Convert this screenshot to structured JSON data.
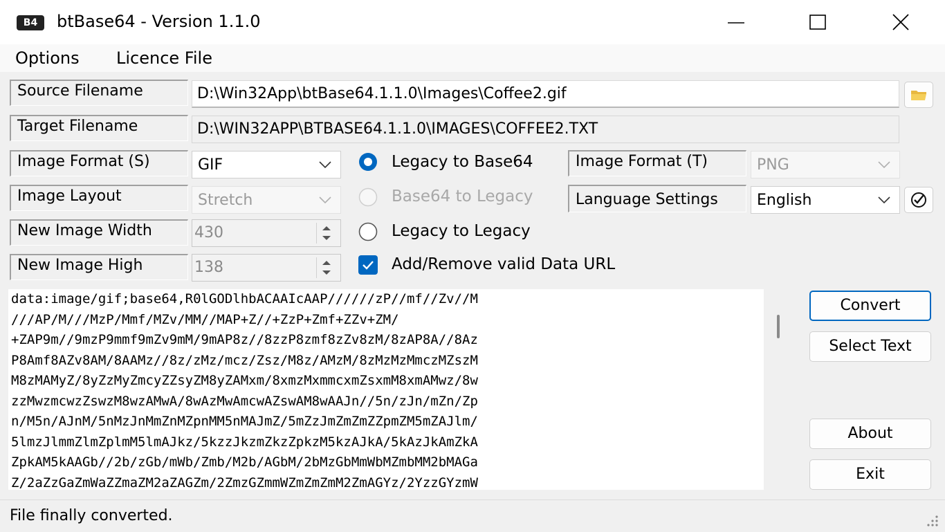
{
  "window": {
    "icon_text": "B4",
    "title": "btBase64 - Version  1.1.0"
  },
  "menu": {
    "options": "Options",
    "licence": "Licence File"
  },
  "labels": {
    "source_filename": "Source Filename",
    "target_filename": "Target Filename",
    "image_format_s": "Image Format (S)",
    "image_layout": "Image Layout",
    "new_image_width": "New Image Width",
    "new_image_high": "New Image High",
    "image_format_t": "Image Format (T)",
    "language_settings": "Language Settings"
  },
  "fields": {
    "source_filename": "D:\\Win32App\\btBase64.1.1.0\\Images\\Coffee2.gif",
    "target_filename": "D:\\WIN32APP\\BTBASE64.1.1.0\\IMAGES\\COFFEE2.TXT",
    "image_format_s": "GIF",
    "image_layout": "Stretch",
    "new_image_width": "430",
    "new_image_high": "138",
    "image_format_t": "PNG",
    "language": "English"
  },
  "options": {
    "legacy_to_base64": "Legacy to Base64",
    "base64_to_legacy": "Base64 to Legacy",
    "legacy_to_legacy": "Legacy to Legacy",
    "add_remove_data_url": "Add/Remove valid Data URL",
    "selected_mode": "legacy_to_base64",
    "data_url_checked": true
  },
  "output_lines": [
    "data:image/gif;base64,R0lGODlhbACAAIcAAP//////zP//mf//Zv//M",
    "///AP/M///MzP/Mmf/MZv/MM//MAP+Z//+ZzP+Zmf+ZZv+ZM/",
    "+ZAP9m//9mzP9mmf9mZv9mM/9mAP8z//8zzP8zmf8zZv8zM/8zAP8A//8Az",
    "P8Amf8AZv8AM/8AAMz//8z/zMz/mcz/Zsz/M8z/AMzM/8zMzMzMmczMZszM",
    "M8zMAMyZ/8yZzMyZmcyZZsyZM8yZAMxm/8xmzMxmmcxmZsxmM8xmAMwz/8w",
    "zzMwzmcwzZswzM8wzAMwA/8wAzMwAmcwAZswAM8wAAJn//5n/zJn/mZn/Zp",
    "n/M5n/AJnM/5nMzJnMmZnMZpnMM5nMAJmZ/5mZzJmZmZmZZpmZM5mZAJlm/",
    "5lmzJlmmZlmZplmM5lmAJkz/5kzzJkzmZkzZpkzM5kzAJkA/5kAzJkAmZkA",
    "ZpkAM5kAAGb//2b/zGb/mWb/Zmb/M2b/AGbM/2bMzGbMmWbMZmbMM2bMAGa",
    "Z/2aZzGaZmWaZZmaZM2aZAGZm/2ZmzGZmmWZmZmZmM2ZmAGYz/2YzzGYzmW"
  ],
  "buttons": {
    "convert": "Convert",
    "select_text": "Select Text",
    "about": "About",
    "exit": "Exit"
  },
  "status": {
    "text": "File finally converted."
  },
  "colors": {
    "accent": "#0067c0"
  }
}
